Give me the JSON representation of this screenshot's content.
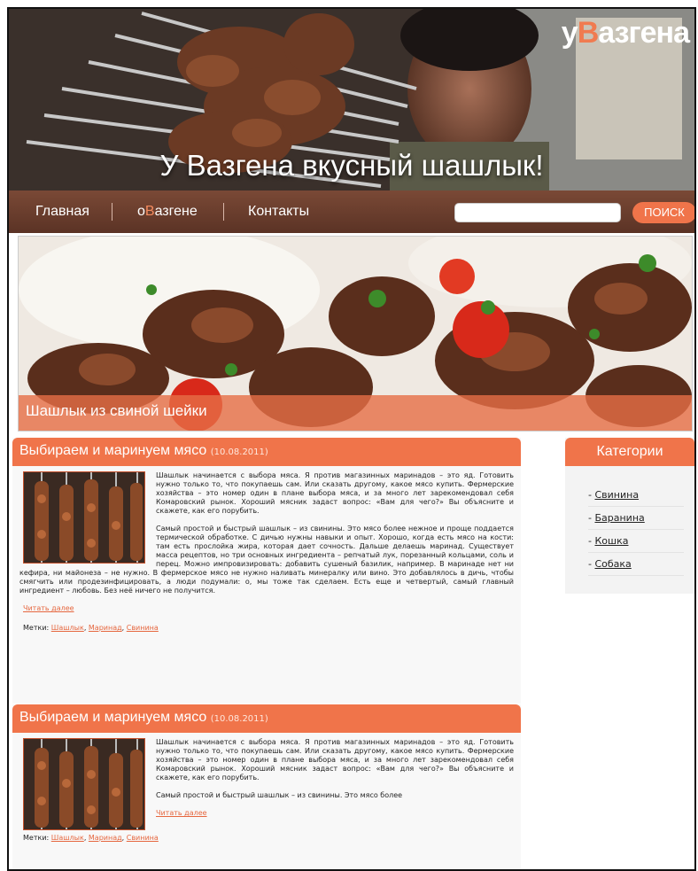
{
  "header": {
    "logo_prefix": "у",
    "logo_accent": "В",
    "logo_suffix": "азгена",
    "tagline": "У Вазгена вкусный шашлык!"
  },
  "nav": {
    "items": [
      {
        "label": "Главная"
      },
      {
        "label_prefix": "о",
        "label_accent": "В",
        "label_suffix": "азгене"
      },
      {
        "label": "Контакты"
      }
    ],
    "search_placeholder": "",
    "search_button": "ПОИСК"
  },
  "slider": {
    "caption": "Шашлык из свиной шейки"
  },
  "posts": [
    {
      "title": "Выбираем и маринуем мясо",
      "date": "(10.08.2011)",
      "paragraphs": [
        "Шашлык начинается с выбора мяса. Я против магазинных маринадов – это яд. Готовить нужно только то, что покупаешь сам. Или сказать другому, какое мясо купить. Фермерские хозяйства – это номер один в плане выбора мяса, и за много лет зарекомендовал себя Комаровский рынок. Хороший мясник задаст вопрос: «Вам для чего?» Вы объясните и скажете, как его порубить.",
        "Самый простой и быстрый шашлык – из свинины. Это мясо более нежное и проще поддается термической обработке. С дичью нужны навыки и опыт. Хорошо, когда есть мясо на кости: там есть прослойка жира, которая дает сочность. Дальше делаешь маринад. Существует масса рецептов, но три основных ингредиента – репчатый лук, порезанный кольцами, соль и перец. Можно импровизировать: добавить сушеный базилик, например. В маринаде нет ни кефира, ни майонеза – не нужно. В фермерское мясо не нужно наливать минералку или вино. Это добавлялось в дичь, чтобы смягчить или продезинфицировать, а люди подумали: о, мы тоже так сделаем. Есть еще и четвертый, самый главный ингредиент – любовь. Без неё ничего не получится."
      ],
      "read_more": "Читать далее",
      "tags_label": "Метки:",
      "tags": [
        "Шашлык",
        "Маринад",
        "Свинина"
      ]
    },
    {
      "title": "Выбираем и маринуем мясо",
      "date": "(10.08.2011)",
      "paragraphs": [
        "Шашлык начинается с выбора мяса. Я против магазинных маринадов – это яд. Готовить нужно только то, что покупаешь сам. Или сказать другому, какое мясо купить. Фермерские хозяйства – это номер один в плане выбора мяса, и за много лет зарекомендовал себя Комаровский рынок. Хороший мясник задаст вопрос: «Вам для чего?» Вы объясните и скажете, как его порубить.",
        "Самый простой и быстрый шашлык – из свинины. Это мясо более"
      ],
      "read_more": "Читать далее",
      "tags_label": "Метки:",
      "tags": [
        "Шашлык",
        "Маринад",
        "Свинина"
      ]
    }
  ],
  "sidebar": {
    "title": "Категории",
    "categories": [
      "Свинина",
      "Баранина",
      "Кошка",
      "Собака"
    ]
  },
  "colors": {
    "accent": "#f0744a",
    "nav_bg": "#6a3d2d",
    "link": "#e6673f"
  }
}
